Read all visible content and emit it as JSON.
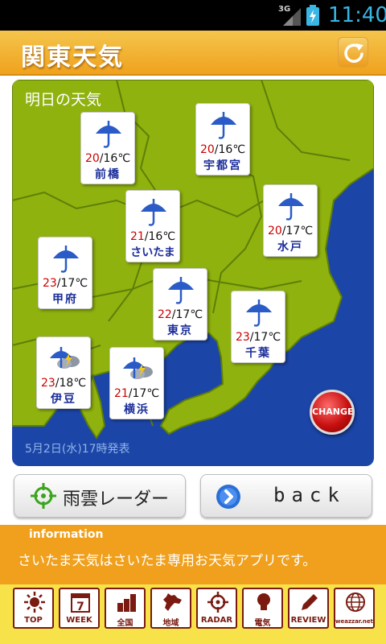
{
  "status_bar": {
    "network": "3G",
    "time": "11:40"
  },
  "header": {
    "title": "関東天気",
    "refresh_icon": "refresh-icon"
  },
  "map": {
    "title": "明日の天気",
    "published": "5月2日(水)17時発表",
    "colors": {
      "sea": "#1c45a8",
      "land": "#8fb20e",
      "border": "#5e7e08"
    },
    "forecasts": [
      {
        "city": "前橋",
        "high": "20",
        "low": "16",
        "unit": "℃",
        "weather_icon": "umbrella-icon"
      },
      {
        "city": "宇都宮",
        "high": "20",
        "low": "16",
        "unit": "℃",
        "weather_icon": "umbrella-icon"
      },
      {
        "city": "さいたま",
        "high": "21",
        "low": "16",
        "unit": "℃",
        "weather_icon": "umbrella-icon"
      },
      {
        "city": "水戸",
        "high": "20",
        "low": "17",
        "unit": "℃",
        "weather_icon": "umbrella-icon"
      },
      {
        "city": "甲府",
        "high": "23",
        "low": "17",
        "unit": "℃",
        "weather_icon": "umbrella-icon"
      },
      {
        "city": "東京",
        "high": "22",
        "low": "17",
        "unit": "℃",
        "weather_icon": "umbrella-icon"
      },
      {
        "city": "千葉",
        "high": "23",
        "low": "17",
        "unit": "℃",
        "weather_icon": "umbrella-icon"
      },
      {
        "city": "伊豆",
        "high": "23",
        "low": "18",
        "unit": "℃",
        "weather_icon": "umbrella-thunder-icon"
      },
      {
        "city": "横浜",
        "high": "21",
        "low": "17",
        "unit": "℃",
        "weather_icon": "umbrella-thunder-icon"
      }
    ],
    "change_label": "CHANGE"
  },
  "buttons": {
    "radar_label": "雨雲レーダー",
    "back_label": "back"
  },
  "info": {
    "heading": "information",
    "text": "さいたま天気はさいたま専用お天気アプリです。"
  },
  "toolbar": {
    "items": [
      {
        "label": "TOP",
        "icon": "sun-icon"
      },
      {
        "label": "WEEK",
        "icon": "calendar-icon",
        "icon_text": "7"
      },
      {
        "label": "全国",
        "icon": "bar-chart-icon"
      },
      {
        "label": "地域",
        "icon": "hokkaido-map-icon"
      },
      {
        "label": "RADAR",
        "icon": "crosshair-icon"
      },
      {
        "label": "電気",
        "icon": "lightbulb-icon"
      },
      {
        "label": "REVIEW",
        "icon": "pencil-icon"
      },
      {
        "label": "weazzar.net",
        "icon": "globe-icon"
      }
    ]
  }
}
